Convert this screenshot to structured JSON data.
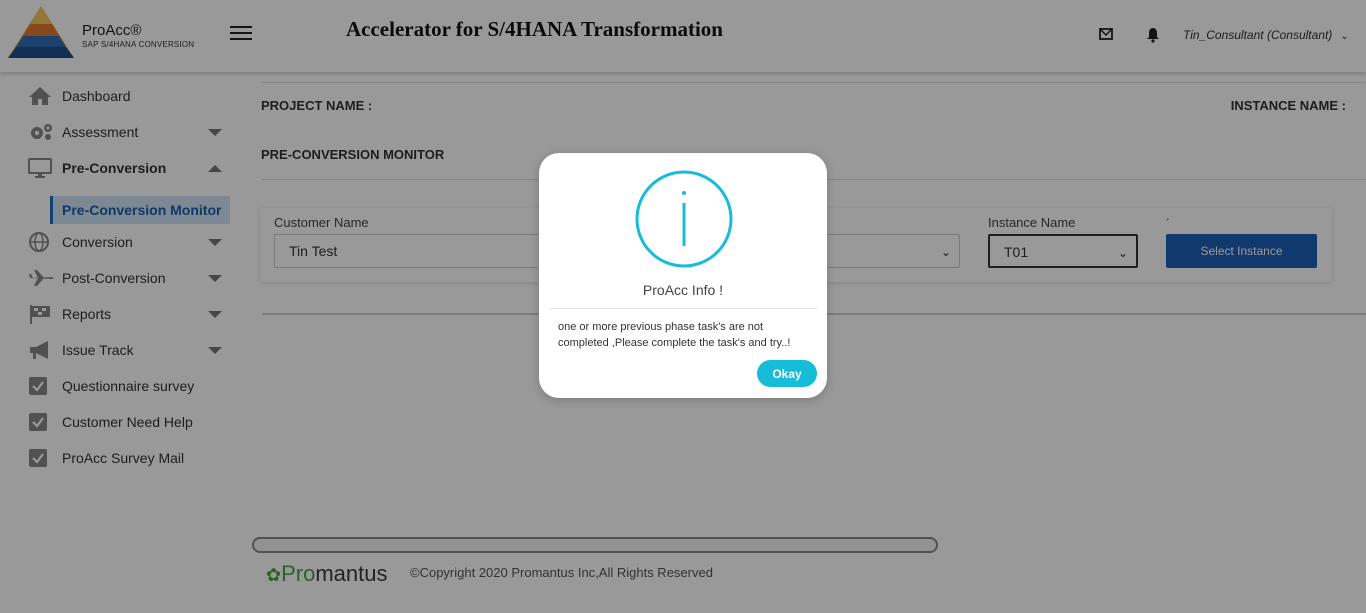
{
  "header": {
    "brand_name": "ProAcc®",
    "brand_sub": "SAP S/4HANA CONVERSION",
    "title": "Accelerator for S/4HANA Transformation",
    "user": "Tin_Consultant (Consultant)",
    "icons": [
      "menu-icon",
      "mail-icon",
      "bell-icon",
      "chevron-down-icon"
    ]
  },
  "sidebar": {
    "items": [
      {
        "label": "Dashboard",
        "icon": "home-icon"
      },
      {
        "label": "Assessment",
        "icon": "gears-icon"
      },
      {
        "label": "Pre-Conversion",
        "icon": "monitor-icon"
      },
      {
        "label": "Conversion",
        "icon": "globe-icon"
      },
      {
        "label": "Post-Conversion",
        "icon": "plane-icon"
      },
      {
        "label": "Reports",
        "icon": "flag-icon"
      },
      {
        "label": "Issue Track",
        "icon": "megaphone-icon"
      },
      {
        "label": "Questionnaire survey",
        "icon": "checkbox-icon"
      },
      {
        "label": "Customer Need Help",
        "icon": "checkbox-icon"
      },
      {
        "label": "ProAcc Survey Mail",
        "icon": "checkbox-icon"
      }
    ],
    "sub_item": "Pre-Conversion Monitor"
  },
  "main": {
    "project_name_label": "PROJECT NAME :",
    "instance_name_label": "INSTANCE NAME :",
    "section_title": "PRE-CONVERSION MONITOR",
    "customer_label": "Customer Name",
    "customer_value": "Tin Test",
    "instance_label": "Instance Name",
    "instance_value": "T01",
    "dot_label": ".",
    "select_button": "Select Instance"
  },
  "footer": {
    "logo_pro": "Pro",
    "logo_rest": "mantus",
    "copyright": "©Copyright 2020 Promantus Inc,All Rights Reserved"
  },
  "modal": {
    "title": "ProAcc Info !",
    "message": "one or more previous phase task's are not completed ,Please complete the task's and try..!",
    "button": "Okay"
  },
  "colors": {
    "accent_blue": "#1e5fb8",
    "modal_accent": "#17bcd8",
    "active_sub_bg": "#cfe3f5"
  }
}
